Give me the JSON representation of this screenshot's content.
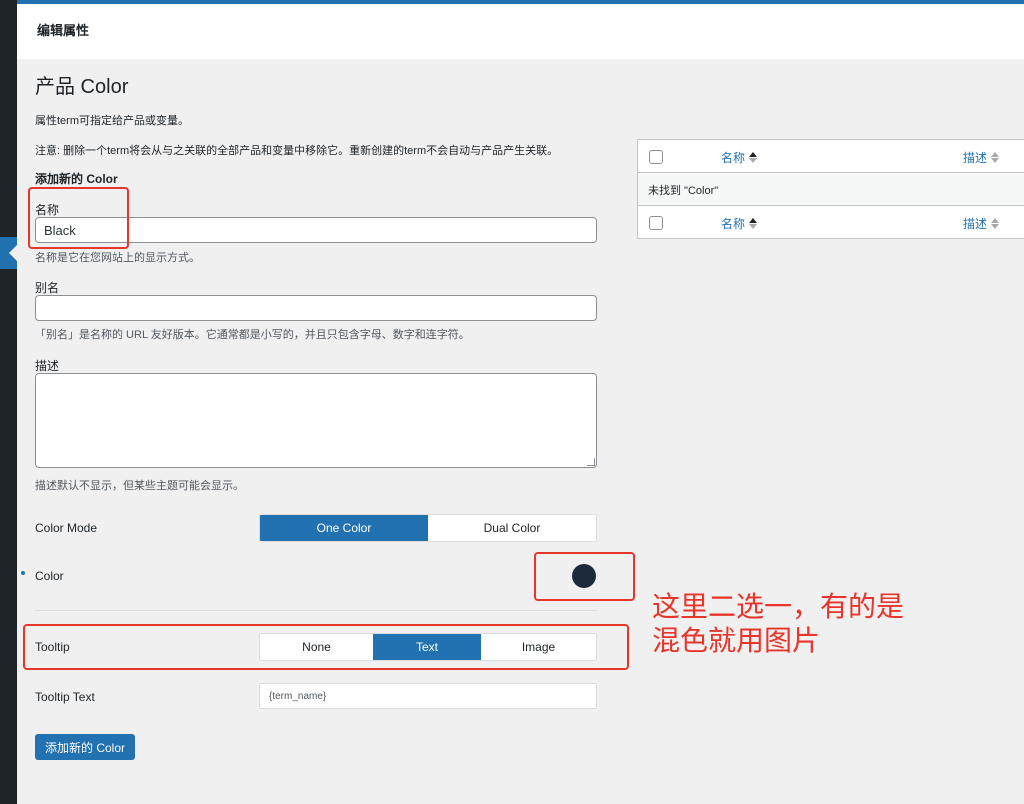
{
  "header": {
    "title": "编辑属性"
  },
  "page": {
    "title": "产品 Color",
    "desc1": "属性term可指定给产品或变量。",
    "desc2": "注意: 删除一个term将会从与之关联的全部产品和变量中移除它。重新创建的term不会自动与产品产生关联。"
  },
  "form": {
    "section_title": "添加新的 Color",
    "name_label": "名称",
    "name_value": "Black",
    "name_hint": "名称是它在您网站上的显示方式。",
    "slug_label": "别名",
    "slug_value": "",
    "slug_hint": "「别名」是名称的 URL 友好版本。它通常都是小写的，并且只包含字母、数字和连字符。",
    "desc_label": "描述",
    "desc_hint": "描述默认不显示，但某些主题可能会显示。",
    "color_mode_label": "Color Mode",
    "color_mode_options": [
      "One Color",
      "Dual Color"
    ],
    "color_mode_selected": "One Color",
    "color_label": "Color",
    "color_value": "#1d2a3b",
    "tooltip_label": "Tooltip",
    "tooltip_options": [
      "None",
      "Text",
      "Image"
    ],
    "tooltip_selected": "Text",
    "tooltip_text_label": "Tooltip Text",
    "tooltip_text_value": "{term_name}",
    "submit_label": "添加新的 Color"
  },
  "table": {
    "col_name": "名称",
    "col_desc": "描述",
    "empty_message": "未找到 \"Color\""
  },
  "annotation": {
    "line1": "这里二选一，有的是",
    "line2": "混色就用图片"
  },
  "colors": {
    "accent": "#2271b1",
    "annotation": "#e8352b"
  }
}
